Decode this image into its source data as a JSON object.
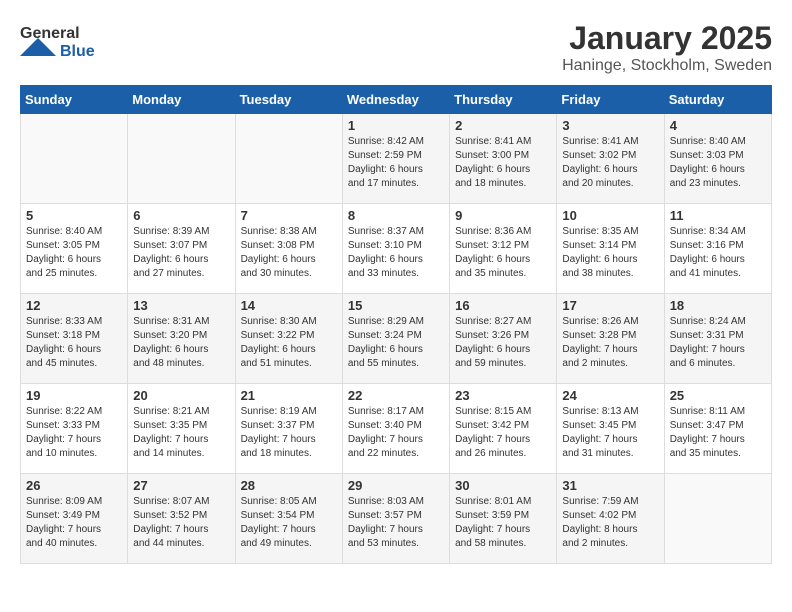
{
  "header": {
    "logo_general": "General",
    "logo_blue": "Blue",
    "title": "January 2025",
    "location": "Haninge, Stockholm, Sweden"
  },
  "weekdays": [
    "Sunday",
    "Monday",
    "Tuesday",
    "Wednesday",
    "Thursday",
    "Friday",
    "Saturday"
  ],
  "weeks": [
    [
      {
        "day": "",
        "info": ""
      },
      {
        "day": "",
        "info": ""
      },
      {
        "day": "",
        "info": ""
      },
      {
        "day": "1",
        "info": "Sunrise: 8:42 AM\nSunset: 2:59 PM\nDaylight: 6 hours\nand 17 minutes."
      },
      {
        "day": "2",
        "info": "Sunrise: 8:41 AM\nSunset: 3:00 PM\nDaylight: 6 hours\nand 18 minutes."
      },
      {
        "day": "3",
        "info": "Sunrise: 8:41 AM\nSunset: 3:02 PM\nDaylight: 6 hours\nand 20 minutes."
      },
      {
        "day": "4",
        "info": "Sunrise: 8:40 AM\nSunset: 3:03 PM\nDaylight: 6 hours\nand 23 minutes."
      }
    ],
    [
      {
        "day": "5",
        "info": "Sunrise: 8:40 AM\nSunset: 3:05 PM\nDaylight: 6 hours\nand 25 minutes."
      },
      {
        "day": "6",
        "info": "Sunrise: 8:39 AM\nSunset: 3:07 PM\nDaylight: 6 hours\nand 27 minutes."
      },
      {
        "day": "7",
        "info": "Sunrise: 8:38 AM\nSunset: 3:08 PM\nDaylight: 6 hours\nand 30 minutes."
      },
      {
        "day": "8",
        "info": "Sunrise: 8:37 AM\nSunset: 3:10 PM\nDaylight: 6 hours\nand 33 minutes."
      },
      {
        "day": "9",
        "info": "Sunrise: 8:36 AM\nSunset: 3:12 PM\nDaylight: 6 hours\nand 35 minutes."
      },
      {
        "day": "10",
        "info": "Sunrise: 8:35 AM\nSunset: 3:14 PM\nDaylight: 6 hours\nand 38 minutes."
      },
      {
        "day": "11",
        "info": "Sunrise: 8:34 AM\nSunset: 3:16 PM\nDaylight: 6 hours\nand 41 minutes."
      }
    ],
    [
      {
        "day": "12",
        "info": "Sunrise: 8:33 AM\nSunset: 3:18 PM\nDaylight: 6 hours\nand 45 minutes."
      },
      {
        "day": "13",
        "info": "Sunrise: 8:31 AM\nSunset: 3:20 PM\nDaylight: 6 hours\nand 48 minutes."
      },
      {
        "day": "14",
        "info": "Sunrise: 8:30 AM\nSunset: 3:22 PM\nDaylight: 6 hours\nand 51 minutes."
      },
      {
        "day": "15",
        "info": "Sunrise: 8:29 AM\nSunset: 3:24 PM\nDaylight: 6 hours\nand 55 minutes."
      },
      {
        "day": "16",
        "info": "Sunrise: 8:27 AM\nSunset: 3:26 PM\nDaylight: 6 hours\nand 59 minutes."
      },
      {
        "day": "17",
        "info": "Sunrise: 8:26 AM\nSunset: 3:28 PM\nDaylight: 7 hours\nand 2 minutes."
      },
      {
        "day": "18",
        "info": "Sunrise: 8:24 AM\nSunset: 3:31 PM\nDaylight: 7 hours\nand 6 minutes."
      }
    ],
    [
      {
        "day": "19",
        "info": "Sunrise: 8:22 AM\nSunset: 3:33 PM\nDaylight: 7 hours\nand 10 minutes."
      },
      {
        "day": "20",
        "info": "Sunrise: 8:21 AM\nSunset: 3:35 PM\nDaylight: 7 hours\nand 14 minutes."
      },
      {
        "day": "21",
        "info": "Sunrise: 8:19 AM\nSunset: 3:37 PM\nDaylight: 7 hours\nand 18 minutes."
      },
      {
        "day": "22",
        "info": "Sunrise: 8:17 AM\nSunset: 3:40 PM\nDaylight: 7 hours\nand 22 minutes."
      },
      {
        "day": "23",
        "info": "Sunrise: 8:15 AM\nSunset: 3:42 PM\nDaylight: 7 hours\nand 26 minutes."
      },
      {
        "day": "24",
        "info": "Sunrise: 8:13 AM\nSunset: 3:45 PM\nDaylight: 7 hours\nand 31 minutes."
      },
      {
        "day": "25",
        "info": "Sunrise: 8:11 AM\nSunset: 3:47 PM\nDaylight: 7 hours\nand 35 minutes."
      }
    ],
    [
      {
        "day": "26",
        "info": "Sunrise: 8:09 AM\nSunset: 3:49 PM\nDaylight: 7 hours\nand 40 minutes."
      },
      {
        "day": "27",
        "info": "Sunrise: 8:07 AM\nSunset: 3:52 PM\nDaylight: 7 hours\nand 44 minutes."
      },
      {
        "day": "28",
        "info": "Sunrise: 8:05 AM\nSunset: 3:54 PM\nDaylight: 7 hours\nand 49 minutes."
      },
      {
        "day": "29",
        "info": "Sunrise: 8:03 AM\nSunset: 3:57 PM\nDaylight: 7 hours\nand 53 minutes."
      },
      {
        "day": "30",
        "info": "Sunrise: 8:01 AM\nSunset: 3:59 PM\nDaylight: 7 hours\nand 58 minutes."
      },
      {
        "day": "31",
        "info": "Sunrise: 7:59 AM\nSunset: 4:02 PM\nDaylight: 8 hours\nand 2 minutes."
      },
      {
        "day": "",
        "info": ""
      }
    ]
  ]
}
